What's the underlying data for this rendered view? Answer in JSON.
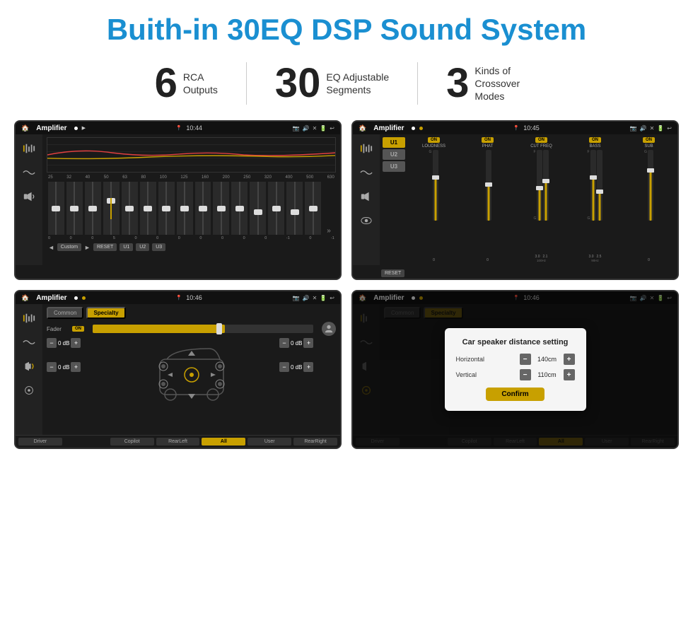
{
  "header": {
    "title": "Buith-in 30EQ DSP Sound System"
  },
  "stats": [
    {
      "number": "6",
      "desc_line1": "RCA",
      "desc_line2": "Outputs"
    },
    {
      "number": "30",
      "desc_line1": "EQ Adjustable",
      "desc_line2": "Segments"
    },
    {
      "number": "3",
      "desc_line1": "Kinds of",
      "desc_line2": "Crossover Modes"
    }
  ],
  "screens": [
    {
      "id": "screen-eq",
      "status_bar": {
        "app_name": "Amplifier",
        "time": "10:44"
      },
      "type": "eq"
    },
    {
      "id": "screen-crossover",
      "status_bar": {
        "app_name": "Amplifier",
        "time": "10:45"
      },
      "type": "crossover"
    },
    {
      "id": "screen-fader",
      "status_bar": {
        "app_name": "Amplifier",
        "time": "10:46"
      },
      "type": "fader"
    },
    {
      "id": "screen-distance",
      "status_bar": {
        "app_name": "Amplifier",
        "time": "10:46"
      },
      "type": "distance",
      "dialog": {
        "title": "Car speaker distance setting",
        "horizontal_label": "Horizontal",
        "horizontal_value": "140cm",
        "vertical_label": "Vertical",
        "vertical_value": "110cm",
        "confirm_label": "Confirm"
      }
    }
  ],
  "eq": {
    "freqs": [
      "25",
      "32",
      "40",
      "50",
      "63",
      "80",
      "100",
      "125",
      "160",
      "200",
      "250",
      "320",
      "400",
      "500",
      "630"
    ],
    "values": [
      "0",
      "0",
      "0",
      "5",
      "0",
      "0",
      "0",
      "0",
      "0",
      "0",
      "0",
      "-1",
      "0",
      "-1"
    ],
    "buttons": [
      "Custom",
      "RESET",
      "U1",
      "U2",
      "U3"
    ]
  },
  "crossover": {
    "u_labels": [
      "U1",
      "U2",
      "U3"
    ],
    "channels": [
      {
        "label": "LOUDNESS",
        "on": true
      },
      {
        "label": "PHAT",
        "on": true
      },
      {
        "label": "CUT FREQ",
        "on": true
      },
      {
        "label": "BASS",
        "on": true
      },
      {
        "label": "SUB",
        "on": true
      }
    ],
    "reset_label": "RESET"
  },
  "fader": {
    "tabs": [
      "Common",
      "Specialty"
    ],
    "active_tab": "Specialty",
    "fader_label": "Fader",
    "fader_on": "ON",
    "buttons": {
      "driver": "Driver",
      "copilot": "Copilot",
      "rear_left": "RearLeft",
      "all": "All",
      "user": "User",
      "rear_right": "RearRight"
    },
    "db_values": [
      "0 dB",
      "0 dB",
      "0 dB",
      "0 dB"
    ]
  },
  "distance": {
    "tabs": [
      "Common",
      "Specialty"
    ],
    "buttons": {
      "driver": "Driver",
      "copilot": "Copilot",
      "rear_left": "RearLeft",
      "all": "All",
      "user": "User",
      "rear_right": "RearRight"
    },
    "dialog": {
      "title": "Car speaker distance setting",
      "horizontal_label": "Horizontal",
      "horizontal_value": "140cm",
      "vertical_label": "Vertical",
      "vertical_value": "110cm",
      "confirm_label": "Confirm"
    }
  }
}
